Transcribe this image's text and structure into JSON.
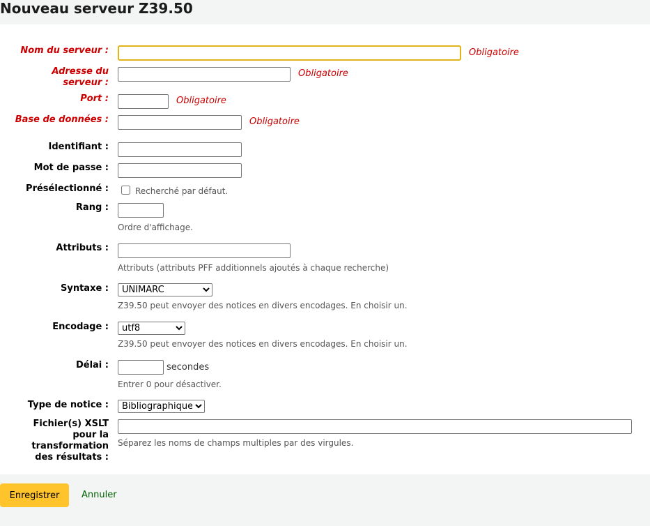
{
  "page_title": "Nouveau serveur Z39.50",
  "required_text": "Obligatoire",
  "fields": {
    "name": {
      "label": "Nom du serveur :",
      "value": ""
    },
    "host": {
      "label": "Adresse du serveur :",
      "value": ""
    },
    "port": {
      "label": "Port :",
      "value": ""
    },
    "db": {
      "label": "Base de données :",
      "value": ""
    },
    "userid": {
      "label": "Identifiant :",
      "value": ""
    },
    "password": {
      "label": "Mot de passe :",
      "value": ""
    },
    "checked": {
      "label": "Présélectionné :",
      "checkbox_text": "Recherché par défaut."
    },
    "rank": {
      "label": "Rang :",
      "value": "",
      "hint": "Ordre d'affichage."
    },
    "attributes": {
      "label": "Attributs :",
      "value": "",
      "hint": "Attributs (attributs PFF additionnels ajoutés à chaque recherche)"
    },
    "syntax": {
      "label": "Syntaxe :",
      "selected": "UNIMARC",
      "hint": "Z39.50 peut envoyer des notices en divers encodages. En choisir un."
    },
    "encoding": {
      "label": "Encodage :",
      "selected": "utf8",
      "hint": "Z39.50 peut envoyer des notices en divers encodages. En choisir un."
    },
    "timeout": {
      "label": "Délai :",
      "value": "",
      "unit": "secondes",
      "hint": "Entrer 0 pour désactiver."
    },
    "recordtype": {
      "label": "Type de notice :",
      "selected": "Bibliographique"
    },
    "xslt": {
      "label": "Fichier(s) XSLT pour la transformation des résultats :",
      "value": "",
      "hint": "Séparez les noms de champs multiples par des virgules."
    }
  },
  "actions": {
    "save_label": "Enregistrer",
    "cancel_label": "Annuler"
  },
  "colors": {
    "required": "#cc0000",
    "save_button": "#ffc32b",
    "focus_border": "#e0b31a",
    "cancel_link": "#006100"
  }
}
